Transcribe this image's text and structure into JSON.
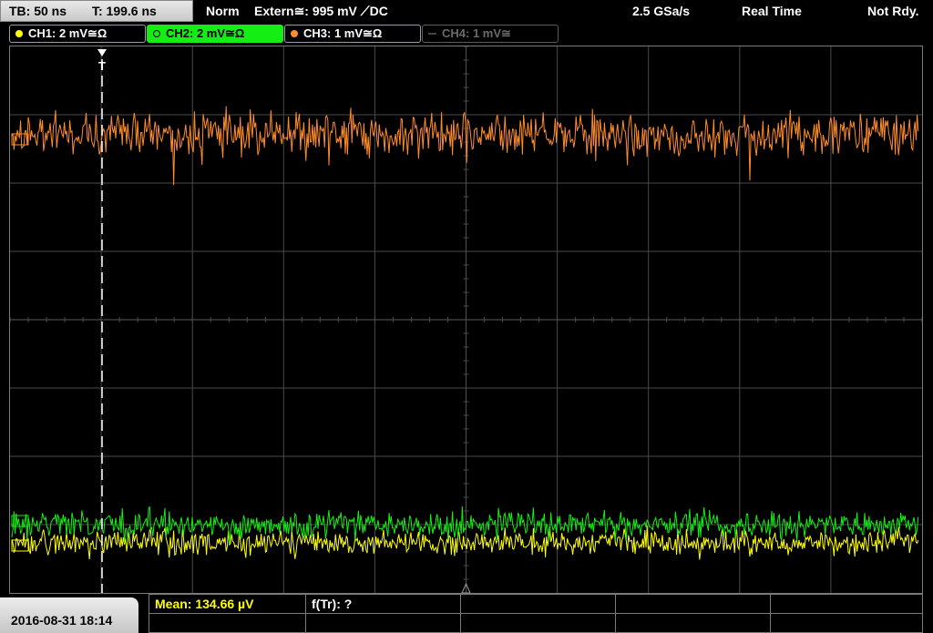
{
  "status": {
    "timebase": "TB: 50 ns",
    "trigger_time": "T: 199.6 ns",
    "mode": "Norm",
    "trigger_source": "Extern≅: 995 mV ⟋DC",
    "sample_rate": "2.5 GSa/s",
    "acq_mode": "Real Time",
    "state": "Not Rdy."
  },
  "channels": [
    {
      "label": "CH1: 2 mV≅Ω",
      "color": "#ffff00",
      "active": false,
      "enabled": true
    },
    {
      "label": "CH2: 2 mV≅Ω",
      "color": "#14ee14",
      "active": true,
      "enabled": true
    },
    {
      "label": "CH3: 1 mV≅Ω",
      "color": "#ff8c2a",
      "active": false,
      "enabled": true
    },
    {
      "label": "CH4: 1 mV≅",
      "color": "#6a6a6a",
      "active": false,
      "enabled": false
    }
  ],
  "markers": {
    "trigger_position": "T"
  },
  "measurements": {
    "mean": "Mean: 134.66 µV",
    "freq": "f(Tr): ?"
  },
  "datetime": "2016-08-31 18:14",
  "colors": {
    "grid": "#4a4a4a",
    "ch1": "#ffff00",
    "ch2": "#14ee14",
    "ch3": "#ff8c2a",
    "measure_text": "#ffff00"
  }
}
